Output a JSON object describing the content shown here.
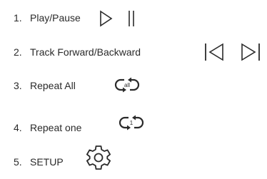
{
  "items": [
    {
      "number": "1.",
      "label": "Play/Pause",
      "icons": [
        "play-icon",
        "pause-icon"
      ]
    },
    {
      "number": "2.",
      "label": "Track Forward/Backward",
      "icons": [
        "track-backward-icon",
        "track-forward-icon"
      ]
    },
    {
      "number": "3.",
      "label": "Repeat All",
      "icons": [
        "repeat-all-icon"
      ],
      "icon_text": "all"
    },
    {
      "number": "4.",
      "label": "Repeat one",
      "icons": [
        "repeat-one-icon"
      ],
      "icon_text": "1"
    },
    {
      "number": "5.",
      "label": "SETUP",
      "icons": [
        "gear-icon"
      ]
    }
  ],
  "colors": {
    "text": "#2a2a2a",
    "background": "#ffffff"
  }
}
